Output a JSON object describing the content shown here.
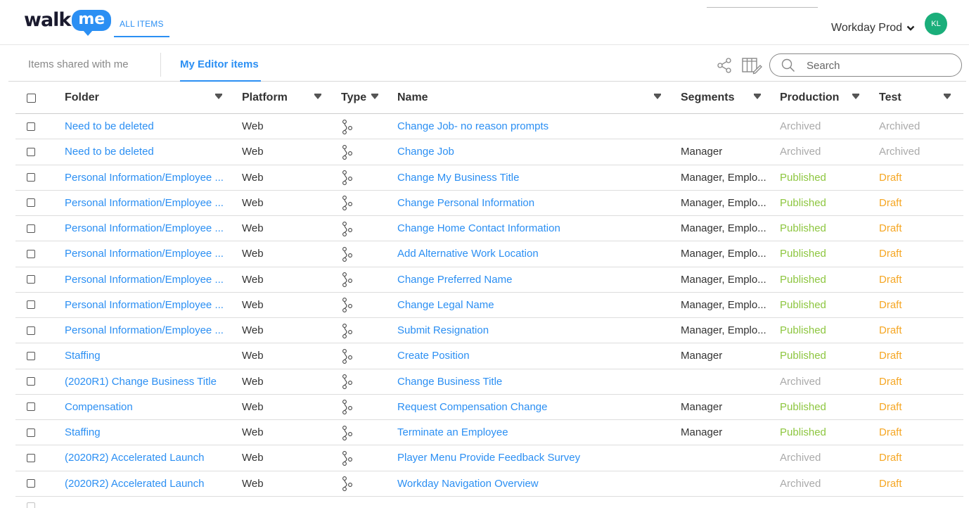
{
  "app": {
    "logo_walk": "walk",
    "logo_me": "me",
    "nav_all_items": "ALL ITEMS",
    "environment": "Workday Prod",
    "avatar_initials": "KL"
  },
  "tabs": {
    "shared": "Items shared with me",
    "mine": "My Editor items"
  },
  "search": {
    "placeholder": "Search"
  },
  "colors": {
    "accent": "#2b8ff3",
    "published": "#8dc63f",
    "draft": "#f5a623",
    "archived": "#aaaaaa",
    "avatar": "#1aae7a"
  },
  "table": {
    "columns": {
      "folder": "Folder",
      "platform": "Platform",
      "type": "Type",
      "name": "Name",
      "segments": "Segments",
      "production": "Production",
      "test": "Test"
    },
    "type_icon": "flow-icon",
    "rows": [
      {
        "folder": "Need to be deleted",
        "platform": "Web",
        "name": "Change Job- no reason prompts",
        "segments": "",
        "production": "Archived",
        "test": "Archived"
      },
      {
        "folder": "Need to be deleted",
        "platform": "Web",
        "name": "Change Job",
        "segments": "Manager",
        "production": "Archived",
        "test": "Archived"
      },
      {
        "folder": "Personal Information/Employee ...",
        "platform": "Web",
        "name": "Change My Business Title",
        "segments": "Manager, Emplo...",
        "production": "Published",
        "test": "Draft"
      },
      {
        "folder": "Personal Information/Employee ...",
        "platform": "Web",
        "name": "Change Personal Information",
        "segments": "Manager, Emplo...",
        "production": "Published",
        "test": "Draft"
      },
      {
        "folder": "Personal Information/Employee ...",
        "platform": "Web",
        "name": "Change Home Contact Information",
        "segments": "Manager, Emplo...",
        "production": "Published",
        "test": "Draft"
      },
      {
        "folder": "Personal Information/Employee ...",
        "platform": "Web",
        "name": "Add Alternative Work Location",
        "segments": "Manager, Emplo...",
        "production": "Published",
        "test": "Draft"
      },
      {
        "folder": "Personal Information/Employee ...",
        "platform": "Web",
        "name": "Change Preferred Name",
        "segments": "Manager, Emplo...",
        "production": "Published",
        "test": "Draft"
      },
      {
        "folder": "Personal Information/Employee ...",
        "platform": "Web",
        "name": "Change Legal Name",
        "segments": "Manager, Emplo...",
        "production": "Published",
        "test": "Draft"
      },
      {
        "folder": "Personal Information/Employee ...",
        "platform": "Web",
        "name": "Submit Resignation",
        "segments": "Manager, Emplo...",
        "production": "Published",
        "test": "Draft"
      },
      {
        "folder": "Staffing",
        "platform": "Web",
        "name": "Create Position",
        "segments": "Manager",
        "production": "Published",
        "test": "Draft"
      },
      {
        "folder": "(2020R1) Change Business Title",
        "platform": "Web",
        "name": "Change Business Title",
        "segments": "",
        "production": "Archived",
        "test": "Draft"
      },
      {
        "folder": "Compensation",
        "platform": "Web",
        "name": "Request Compensation Change",
        "segments": "Manager",
        "production": "Published",
        "test": "Draft"
      },
      {
        "folder": "Staffing",
        "platform": "Web",
        "name": "Terminate an Employee",
        "segments": "Manager",
        "production": "Published",
        "test": "Draft"
      },
      {
        "folder": "(2020R2) Accelerated Launch",
        "platform": "Web",
        "name": "Player Menu Provide Feedback Survey",
        "segments": "",
        "production": "Archived",
        "test": "Draft"
      },
      {
        "folder": "(2020R2) Accelerated Launch",
        "platform": "Web",
        "name": "Workday Navigation Overview",
        "segments": "",
        "production": "Archived",
        "test": "Draft"
      }
    ]
  }
}
